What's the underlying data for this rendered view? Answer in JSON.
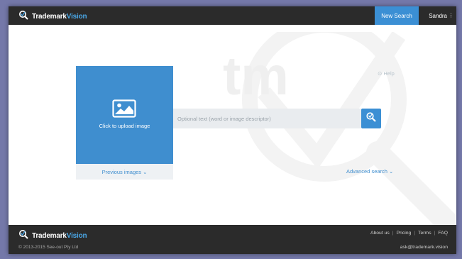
{
  "header": {
    "logo_text_a": "Trademark",
    "logo_text_b": "Vision",
    "new_search_label": "New Search",
    "user_label": "Sandra"
  },
  "main": {
    "upload_label": "Click to upload image",
    "previous_images_label": "Previous images ⌄",
    "search_placeholder": "Optional text (word or image descriptor)",
    "help_label": "⊙ Help",
    "advanced_search_label": "Advanced search ⌄",
    "watermark_text": "tm"
  },
  "footer": {
    "logo_text_a": "Trademark",
    "logo_text_b": "Vision",
    "copyright": "© 2013-2015 See-out Pty Ltd",
    "links": [
      "About us",
      "Pricing",
      "Terms",
      "FAQ"
    ],
    "email": "ask@trademark.vision"
  },
  "colors": {
    "accent": "#3b8fd4",
    "topbar": "#2b2b2b",
    "outer_background": "#7478a9"
  }
}
